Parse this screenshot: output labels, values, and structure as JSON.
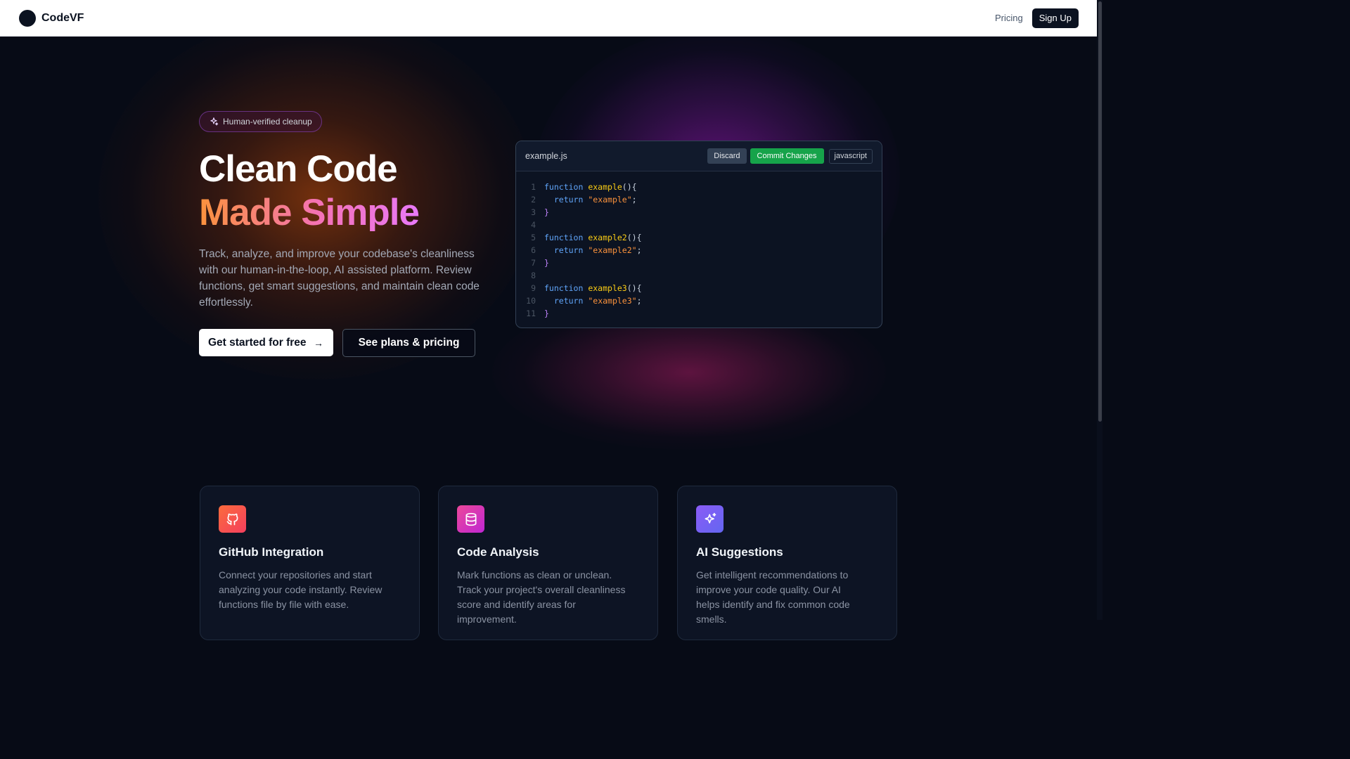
{
  "header": {
    "brand": "CodeVF",
    "nav_pricing": "Pricing",
    "signup_label": "Sign Up"
  },
  "hero": {
    "badge": "Human-verified cleanup",
    "title_line1": "Clean Code",
    "title_line2": "Made Simple",
    "lead": "Track, analyze, and improve your codebase's cleanliness with our human-in-the-loop, AI assisted platform. Review functions, get smart suggestions, and maintain clean code effortlessly.",
    "cta_primary": "Get started for free",
    "cta_primary_icon": "arrow-right-icon",
    "cta_secondary": "See plans & pricing",
    "gradient_colors": [
      "#fb923c",
      "#f472b6",
      "#e879f9"
    ]
  },
  "editor": {
    "filename": "example.js",
    "discard_label": "Discard",
    "commit_label": "Commit Changes",
    "language": "javascript",
    "lines": [
      {
        "n": "1",
        "kw": "function",
        "fn": "example",
        "rest": "(){"
      },
      {
        "n": "2",
        "indent": "  ",
        "kw": "return",
        "str": "\"example\"",
        "end": ";"
      },
      {
        "n": "3",
        "brace": "}"
      },
      {
        "n": "4"
      },
      {
        "n": "5",
        "kw": "function",
        "fn": "example2",
        "rest": "(){"
      },
      {
        "n": "6",
        "indent": "  ",
        "kw": "return",
        "str": "\"example2\"",
        "end": ";"
      },
      {
        "n": "7",
        "brace": "}"
      },
      {
        "n": "8"
      },
      {
        "n": "9",
        "kw": "function",
        "fn": "example3",
        "rest": "(){"
      },
      {
        "n": "10",
        "indent": "  ",
        "kw": "return",
        "str": "\"example3\"",
        "end": ";"
      },
      {
        "n": "11",
        "brace": "}"
      }
    ]
  },
  "features": [
    {
      "icon": "github-icon",
      "title": "GitHub Integration",
      "desc": "Connect your repositories and start analyzing your code instantly. Review functions file by file with ease."
    },
    {
      "icon": "database-icon",
      "title": "Code Analysis",
      "desc": "Mark functions as clean or unclean. Track your project's overall cleanliness score and identify areas for improvement."
    },
    {
      "icon": "sparkles-icon",
      "title": "AI Suggestions",
      "desc": "Get intelligent recommendations to improve your code quality. Our AI helps identify and fix common code smells."
    }
  ]
}
